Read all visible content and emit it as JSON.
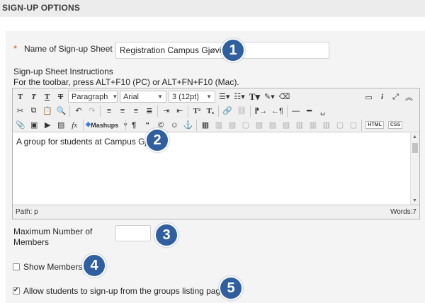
{
  "section": {
    "title": "SIGN-UP OPTIONS"
  },
  "name_field": {
    "required_mark": "*",
    "label": "Name of Sign-up Sheet",
    "value": "Registration Campus Gjøvik"
  },
  "instructions": {
    "label": "Sign-up Sheet Instructions",
    "hint": "For the toolbar, press ALT+F10 (PC) or ALT+FN+F10 (Mac)."
  },
  "editor": {
    "paragraph_select": "Paragraph",
    "font_select": "Arial",
    "size_select": "3 (12pt)",
    "mashups_label": "Mashups",
    "html_label": "HTML",
    "css_label": "CSS",
    "content": "A group for students at Campus Gjøvik.",
    "path_label": "Path: p",
    "word_count": "Words:7"
  },
  "max_members": {
    "label_line1": "Maximum Number of",
    "label_line2": "Members",
    "value": ""
  },
  "show_members": {
    "label": "Show Members",
    "checked": false
  },
  "allow_signup": {
    "label": "Allow students to sign-up from the groups listing page.",
    "checked": true
  },
  "badges": [
    "1",
    "2",
    "3",
    "4",
    "5"
  ]
}
